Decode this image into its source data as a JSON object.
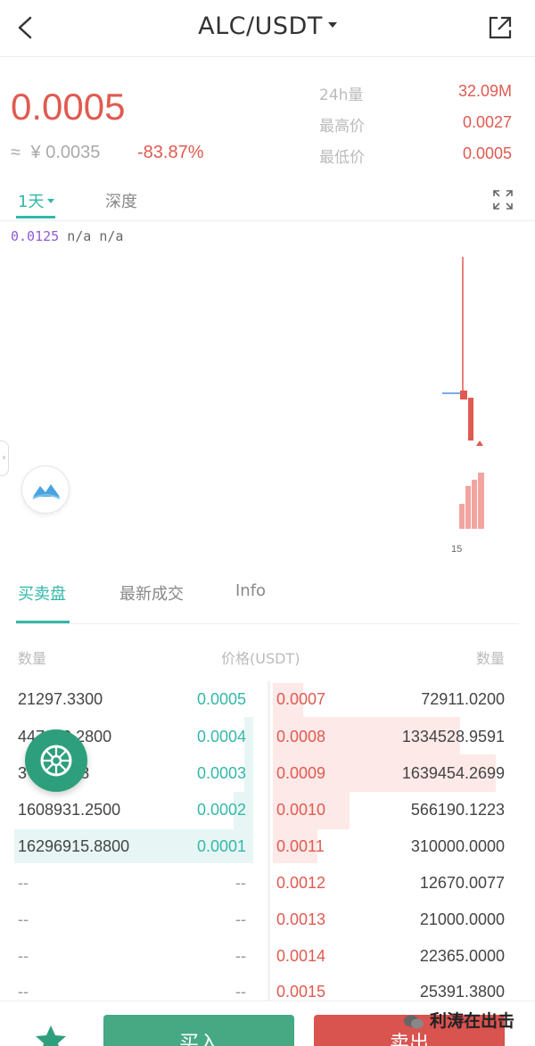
{
  "header": {
    "title": "ALC/USDT"
  },
  "ticker": {
    "last_price": "0.0005",
    "approx_symbol": "≈",
    "approx_cny": "¥ 0.0035",
    "change_pct": "-83.87%",
    "stats": [
      {
        "label": "24h量",
        "value": "32.09M"
      },
      {
        "label": "最高价",
        "value": "0.0027"
      },
      {
        "label": "最低价",
        "value": "0.0005"
      }
    ]
  },
  "period_tabs": {
    "active": "1天",
    "depth": "深度"
  },
  "chart": {
    "ma_value": "0.0125",
    "ma_na1": "n/a",
    "ma_na2": "n/a",
    "x_label": "15",
    "collapse_arrow": "›"
  },
  "book_tabs": [
    "买卖盘",
    "最新成交",
    "Info"
  ],
  "book_headers": {
    "qty_left": "数量",
    "price": "价格(USDT)",
    "qty_right": "数量"
  },
  "bids": [
    {
      "qty": "21297.3300",
      "price": "0.0005"
    },
    {
      "qty": "447??2.2800",
      "price": "0.0004"
    },
    {
      "qty": "3???8668",
      "price": "0.0003"
    },
    {
      "qty": "1608931.2500",
      "price": "0.0002"
    },
    {
      "qty": "16296915.8800",
      "price": "0.0001"
    },
    {
      "qty": "--",
      "price": "--"
    },
    {
      "qty": "--",
      "price": "--"
    },
    {
      "qty": "--",
      "price": "--"
    },
    {
      "qty": "--",
      "price": "--"
    }
  ],
  "asks": [
    {
      "price": "0.0007",
      "qty": "72911.0200"
    },
    {
      "price": "0.0008",
      "qty": "1334528.9591"
    },
    {
      "price": "0.0009",
      "qty": "1639454.2699"
    },
    {
      "price": "0.0010",
      "qty": "566190.1223"
    },
    {
      "price": "0.0011",
      "qty": "310000.0000"
    },
    {
      "price": "0.0012",
      "qty": "12670.0077"
    },
    {
      "price": "0.0013",
      "qty": "21000.0000"
    },
    {
      "price": "0.0014",
      "qty": "22365.0000"
    },
    {
      "price": "0.0015",
      "qty": "25391.3800"
    }
  ],
  "actions": {
    "buy": "买入",
    "sell": "卖出"
  },
  "watermark": "利涛在出击",
  "colors": {
    "up": "#34b7a8",
    "down": "#e05a50",
    "buy": "#46a984",
    "sell": "#d9534f"
  }
}
